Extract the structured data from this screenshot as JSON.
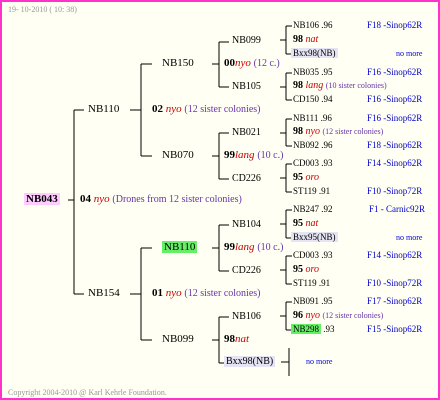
{
  "header": {
    "timestamp": "19- 10-2010 ( 10: 38)"
  },
  "footer": {
    "copyright": "Copyright 2004-2010 @ Karl Kehrle Foundation."
  },
  "root": {
    "id": "NB043",
    "generation": "04",
    "type": "nyo",
    "note": "(Drones from 12 sister colonies)"
  },
  "gen2": [
    {
      "id": "NB110",
      "generation": "02",
      "type": "nyo",
      "note": "(12 sister colonies)"
    },
    {
      "id": "NB154",
      "generation": "01",
      "type": "nyo",
      "note": "(12 sister colonies)"
    }
  ],
  "gen3": [
    {
      "id": "NB150",
      "generation": "00",
      "type": "nyo",
      "note": "(12 c.)"
    },
    {
      "id": "NB070",
      "generation": "99",
      "type": "lang",
      "note": "(10 c.)"
    },
    {
      "id": "NB110",
      "generation": "99",
      "type": "lang",
      "note": "(10 c.)"
    },
    {
      "id": "NB099",
      "generation": "98",
      "type": "nat",
      "note": ""
    }
  ],
  "gen4": [
    {
      "id": "NB099",
      "generation": "98",
      "type": "nat",
      "note": ""
    },
    {
      "id": "NB105",
      "generation": "98",
      "type": "lang",
      "note": "(10 sister colonies)"
    },
    {
      "id": "NB021",
      "generation": "98",
      "type": "nyo",
      "note": "(12 sister colonies)"
    },
    {
      "id": "CD226",
      "generation": "95",
      "type": "oro",
      "note": ""
    },
    {
      "id": "NB104",
      "generation": "95",
      "type": "nat",
      "note": ""
    },
    {
      "id": "CD226",
      "generation": "95",
      "type": "oro",
      "note": ""
    },
    {
      "id": "NB106",
      "generation": "96",
      "type": "nyo",
      "note": "(12 sister colonies)"
    },
    {
      "id": "Bxx98(NB)",
      "generation": "",
      "type": "",
      "note": "no more"
    }
  ],
  "gen5": [
    {
      "id": "NB106",
      "year": ".96",
      "origin": "F18 -Sinop62R"
    },
    {
      "id": "Bxx98(NB)",
      "year": "",
      "origin": "no more"
    },
    {
      "id": "NB035",
      "year": ".95",
      "origin": "F16 -Sinop62R"
    },
    {
      "id": "CD150",
      "year": ".94",
      "origin": "F16 -Sinop62R"
    },
    {
      "id": "NB111",
      "year": ".96",
      "origin": "F16 -Sinop62R"
    },
    {
      "id": "NB092",
      "year": ".96",
      "origin": "F18 -Sinop62R"
    },
    {
      "id": "CD003",
      "year": ".93",
      "origin": "F14 -Sinop62R"
    },
    {
      "id": "ST119",
      "year": ".91",
      "origin": "F10 -Sinop72R"
    },
    {
      "id": "NB247",
      "year": ".92",
      "origin": "F1 - Carnic92R"
    },
    {
      "id": "Bxx95(NB)",
      "year": "",
      "origin": "no more"
    },
    {
      "id": "CD003",
      "year": ".93",
      "origin": "F14 -Sinop62R"
    },
    {
      "id": "ST119",
      "year": ".91",
      "origin": "F10 -Sinop72R"
    },
    {
      "id": "NB091",
      "year": ".95",
      "origin": "F17 -Sinop62R"
    },
    {
      "id": "NB298",
      "year": ".93",
      "origin": "F15 -Sinop62R"
    }
  ],
  "colors": {
    "border": "#ff33cc",
    "highlight_green": "#66ee66",
    "highlight_pink": "#ffccff",
    "link_blue": "#0000cc",
    "mating_red": "#cc0000"
  }
}
